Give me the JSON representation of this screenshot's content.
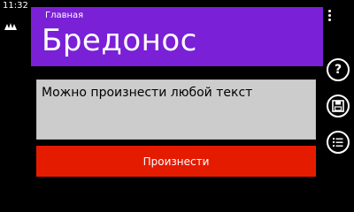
{
  "status": {
    "time": "11:32",
    "icons": [
      "signal-icon"
    ]
  },
  "header": {
    "subtitle": "Главная",
    "title": "Бредонос"
  },
  "input": {
    "value": "Можно произнести любой текст"
  },
  "actions": {
    "speak_label": "Произнести"
  },
  "appbar": {
    "buttons": [
      {
        "icon": "question-icon",
        "glyph": "?"
      },
      {
        "icon": "save-icon"
      },
      {
        "icon": "list-icon"
      }
    ]
  },
  "colors": {
    "header_bg": "#7a20d6",
    "button_bg": "#e51b00",
    "textbox_bg": "#cccccc"
  }
}
